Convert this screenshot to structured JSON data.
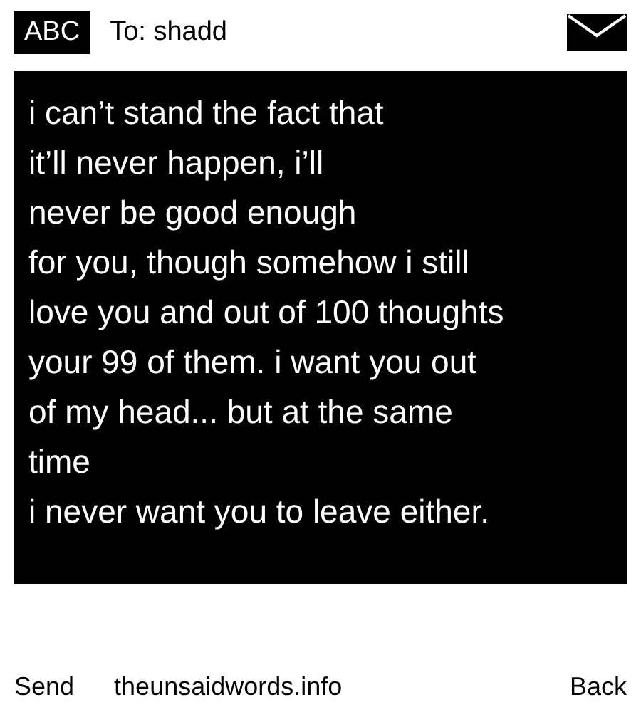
{
  "header": {
    "mode": "ABC",
    "recipient": "To: shadd"
  },
  "message": {
    "lines": [
      "i can’t stand the fact that",
      "it’ll never happen, i’ll",
      "never be good enough",
      "for you, though somehow i still",
      "love you and out of 100 thoughts",
      "your 99 of them. i want you out",
      "of my head... but at the same",
      "time",
      "i never want you to leave either."
    ]
  },
  "footer": {
    "left": "Send",
    "center": "theunsaidwords.info",
    "right": "Back"
  }
}
